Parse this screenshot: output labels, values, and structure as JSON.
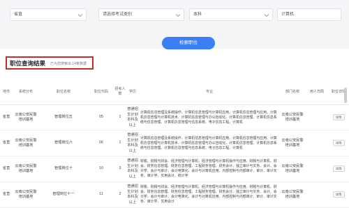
{
  "filters": [
    {
      "value": "省直"
    },
    {
      "value": "请选择考试类别"
    },
    {
      "value": "本科"
    },
    {
      "value": "计算机"
    }
  ],
  "search_button": "检索职位",
  "results": {
    "title": "职位查询结果",
    "count_text": "已为您搜索出 14条数据"
  },
  "table": {
    "headers": [
      "地市",
      "系统分布",
      "职位名称",
      "职位代码",
      "招考人数",
      "学历",
      "专业",
      "部门名称",
      "用人司局",
      "职位详情"
    ],
    "rows": [
      {
        "city": "省直",
        "unit": "云南公安民警培训基地",
        "name": "管理岗位五",
        "code": "05",
        "count": "1",
        "edu": "普通招生计划本科及以上",
        "major": "计算机信息管理及系统操作、计算机信息管理与计算机应用、计算机信息管理与应用、计算机信息管理与计算机技术、计算机信息管理与办公自动化、计算机信息管理、计算机信息系统与信息管理、计算机信息管理与信息系统、电子信息工程、计算机",
        "dept": "云南公安民警培训基地",
        "detail": "详情"
      },
      {
        "city": "省直",
        "unit": "云南公安民警培训基地",
        "name": "管理岗位六",
        "code": "06",
        "count": "1",
        "edu": "普通招生计划本科及以上",
        "major": "计算机信息管理及系统操作、计算机信息管理与计算机应用、计算机信息管理与应用、计算机信息管理与计算机技术、计算机信息管理与办公自动化、计算机信息管理、计算机信息系统与信息管理、计算机信息管理与信息系统、电子信息工程、计算机",
        "dept": "云南公安民警培训基地",
        "detail": "详情"
      },
      {
        "city": "省直",
        "unit": "云南公安民警培训基地",
        "name": "管理岗位十",
        "code": "10",
        "count": "3",
        "edu": "普通招生计划本科及以上",
        "major": "财税、财税与财会、经济管理与计算机、经济管理与计算机操作与应用、财税与计算机、财会、财务信息管理、财务信息管理、工程财务管理、财务会计、独立审计与实务、会计、会计学、会计与审计、会计电算化、会计与计算机应用、内部控制与内部审计、审计、审计实务、审计学、实用会计、统计学",
        "dept": "云南公安民警培训基地",
        "detail": "详情"
      },
      {
        "city": "省直",
        "unit": "云南公安民警培训基地",
        "name": "管理岗位十一",
        "code": "11",
        "count": "2",
        "edu": "普通招生计划本科及以上",
        "major": "财税、财税与财会、经济管理与计算机、经济管理与计算机操作与应用、财税与计算机、财会、财务信息管理、财务信息管理、工程财务管理、财务会计、独立审计与实务、会计、会计学、会计与审计、会计电算化、会计与计算机应用、内部控制与内部审计、审计、审计实务、审计学、实用会计",
        "dept": "云南公安民警培训基地",
        "detail": "详情"
      }
    ]
  }
}
